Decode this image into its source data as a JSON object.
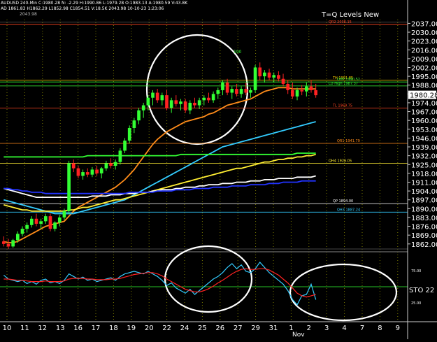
{
  "header": {
    "ohlc_line": "AUDUSD 240-Min  C:1980.28  N:  -2.29  H:1990.86  L:1979.28  O:1983.13  A:1980.59  V:43.8K",
    "line2": "AD 1861.83  H1862.29  L1852.98  C1854.51  V:18.5K  2043.98  10-10-23  1:23:06",
    "corner_value": "2043.98"
  },
  "chart_data": [
    {
      "type": "line",
      "title": "T=Q Levels New",
      "ylim": [
        1858,
        2040
      ],
      "y_ticks": [
        2037.0,
        2030.0,
        2023.0,
        2016.0,
        2009.0,
        2002.0,
        1995.0,
        1988.0,
        1981.0,
        1974.0,
        1967.0,
        1960.0,
        1953.0,
        1946.0,
        1939.0,
        1932.0,
        1925.0,
        1918.0,
        1911.0,
        1904.0,
        1897.0,
        1890.0,
        1883.0,
        1876.0,
        1869.0,
        1862.0
      ],
      "last_price": "1980.28",
      "x_tick_labels": [
        "10",
        "11",
        "12",
        "13",
        "16",
        "17",
        "18",
        "19",
        "20",
        "22",
        "24",
        "25",
        "26",
        "27",
        "29",
        "31",
        "1",
        "2",
        "3",
        "4",
        "7",
        "8",
        "9"
      ],
      "x_month_label": "Nov",
      "candles": [
        {
          "o": 1864,
          "h": 1868,
          "l": 1860,
          "c": 1862
        },
        {
          "o": 1862,
          "h": 1866,
          "l": 1858,
          "c": 1860
        },
        {
          "o": 1860,
          "h": 1866,
          "l": 1859,
          "c": 1865
        },
        {
          "o": 1865,
          "h": 1872,
          "l": 1863,
          "c": 1870
        },
        {
          "o": 1870,
          "h": 1876,
          "l": 1868,
          "c": 1874
        },
        {
          "o": 1874,
          "h": 1879,
          "l": 1871,
          "c": 1877
        },
        {
          "o": 1877,
          "h": 1884,
          "l": 1875,
          "c": 1882
        },
        {
          "o": 1882,
          "h": 1886,
          "l": 1876,
          "c": 1878
        },
        {
          "o": 1878,
          "h": 1882,
          "l": 1874,
          "c": 1880
        },
        {
          "o": 1880,
          "h": 1886,
          "l": 1878,
          "c": 1884
        },
        {
          "o": 1884,
          "h": 1886,
          "l": 1872,
          "c": 1874
        },
        {
          "o": 1874,
          "h": 1880,
          "l": 1872,
          "c": 1879
        },
        {
          "o": 1879,
          "h": 1885,
          "l": 1876,
          "c": 1883
        },
        {
          "o": 1883,
          "h": 1890,
          "l": 1881,
          "c": 1888
        },
        {
          "o": 1888,
          "h": 1928,
          "l": 1886,
          "c": 1926
        },
        {
          "o": 1926,
          "h": 1929,
          "l": 1919,
          "c": 1922
        },
        {
          "o": 1922,
          "h": 1924,
          "l": 1914,
          "c": 1916
        },
        {
          "o": 1916,
          "h": 1921,
          "l": 1913,
          "c": 1919
        },
        {
          "o": 1919,
          "h": 1922,
          "l": 1915,
          "c": 1917
        },
        {
          "o": 1917,
          "h": 1923,
          "l": 1915,
          "c": 1921
        },
        {
          "o": 1921,
          "h": 1924,
          "l": 1916,
          "c": 1918
        },
        {
          "o": 1918,
          "h": 1923,
          "l": 1914,
          "c": 1922
        },
        {
          "o": 1922,
          "h": 1928,
          "l": 1920,
          "c": 1926
        },
        {
          "o": 1926,
          "h": 1930,
          "l": 1922,
          "c": 1924
        },
        {
          "o": 1924,
          "h": 1929,
          "l": 1921,
          "c": 1927
        },
        {
          "o": 1927,
          "h": 1938,
          "l": 1925,
          "c": 1936
        },
        {
          "o": 1936,
          "h": 1946,
          "l": 1934,
          "c": 1944
        },
        {
          "o": 1944,
          "h": 1956,
          "l": 1942,
          "c": 1954
        },
        {
          "o": 1954,
          "h": 1962,
          "l": 1950,
          "c": 1960
        },
        {
          "o": 1960,
          "h": 1970,
          "l": 1957,
          "c": 1968
        },
        {
          "o": 1968,
          "h": 1974,
          "l": 1962,
          "c": 1972
        },
        {
          "o": 1972,
          "h": 1980,
          "l": 1968,
          "c": 1978
        },
        {
          "o": 1978,
          "h": 1984,
          "l": 1972,
          "c": 1982
        },
        {
          "o": 1982,
          "h": 1985,
          "l": 1974,
          "c": 1976
        },
        {
          "o": 1976,
          "h": 1982,
          "l": 1972,
          "c": 1980
        },
        {
          "o": 1980,
          "h": 1984,
          "l": 1968,
          "c": 1970
        },
        {
          "o": 1970,
          "h": 1978,
          "l": 1966,
          "c": 1976
        },
        {
          "o": 1976,
          "h": 1980,
          "l": 1971,
          "c": 1973
        },
        {
          "o": 1973,
          "h": 1977,
          "l": 1968,
          "c": 1975
        },
        {
          "o": 1975,
          "h": 1977,
          "l": 1966,
          "c": 1968
        },
        {
          "o": 1968,
          "h": 1976,
          "l": 1965,
          "c": 1974
        },
        {
          "o": 1974,
          "h": 1978,
          "l": 1970,
          "c": 1972
        },
        {
          "o": 1972,
          "h": 1978,
          "l": 1969,
          "c": 1976
        },
        {
          "o": 1976,
          "h": 1980,
          "l": 1972,
          "c": 1978
        },
        {
          "o": 1978,
          "h": 1982,
          "l": 1974,
          "c": 1976
        },
        {
          "o": 1976,
          "h": 1983,
          "l": 1974,
          "c": 1981
        },
        {
          "o": 1981,
          "h": 1986,
          "l": 1977,
          "c": 1984
        },
        {
          "o": 1984,
          "h": 1992,
          "l": 1980,
          "c": 1990
        },
        {
          "o": 1990,
          "h": 1993,
          "l": 1980,
          "c": 1982
        },
        {
          "o": 1982,
          "h": 1987,
          "l": 1977,
          "c": 1985
        },
        {
          "o": 1985,
          "h": 1989,
          "l": 1979,
          "c": 1981
        },
        {
          "o": 1981,
          "h": 1987,
          "l": 1978,
          "c": 1985
        },
        {
          "o": 1985,
          "h": 1990,
          "l": 1980,
          "c": 1982
        },
        {
          "o": 1982,
          "h": 1986,
          "l": 1978,
          "c": 1984
        },
        {
          "o": 1984,
          "h": 2004,
          "l": 1982,
          "c": 2002
        },
        {
          "o": 2002,
          "h": 2006,
          "l": 1992,
          "c": 1995
        },
        {
          "o": 1995,
          "h": 2000,
          "l": 1990,
          "c": 1998
        },
        {
          "o": 1998,
          "h": 2001,
          "l": 1992,
          "c": 1994
        },
        {
          "o": 1994,
          "h": 1998,
          "l": 1990,
          "c": 1996
        },
        {
          "o": 1996,
          "h": 1999,
          "l": 1991,
          "c": 1993
        },
        {
          "o": 1993,
          "h": 1997,
          "l": 1987,
          "c": 1989
        },
        {
          "o": 1989,
          "h": 1992,
          "l": 1981,
          "c": 1984
        },
        {
          "o": 1984,
          "h": 1990,
          "l": 1977,
          "c": 1979
        },
        {
          "o": 1979,
          "h": 1986,
          "l": 1976,
          "c": 1984
        },
        {
          "o": 1984,
          "h": 1988,
          "l": 1980,
          "c": 1983
        },
        {
          "o": 1983,
          "h": 1990,
          "l": 1979,
          "c": 1987
        },
        {
          "o": 1987,
          "h": 1992,
          "l": 1982,
          "c": 1984
        },
        {
          "o": 1984,
          "h": 1989,
          "l": 1978,
          "c": 1980
        }
      ],
      "moving_averages": [
        {
          "color": "#ff8c1a",
          "values": [
            1864,
            1863,
            1863,
            1864,
            1866,
            1868,
            1870,
            1872,
            1874,
            1876,
            1877,
            1878,
            1879,
            1880,
            1884,
            1888,
            1891,
            1893,
            1895,
            1897,
            1899,
            1901,
            1903,
            1905,
            1907,
            1910,
            1913,
            1917,
            1921,
            1926,
            1931,
            1936,
            1941,
            1945,
            1948,
            1951,
            1953,
            1955,
            1957,
            1959,
            1960,
            1961,
            1962,
            1963,
            1965,
            1966,
            1968,
            1970,
            1972,
            1973,
            1974,
            1975,
            1976,
            1977,
            1979,
            1981,
            1983,
            1984,
            1985,
            1986,
            1986,
            1986,
            1985,
            1985,
            1985,
            1985,
            1985,
            1985
          ]
        },
        {
          "color": "#33ccff",
          "values": [
            1897,
            1896,
            1895,
            1894,
            1893,
            1892,
            1891,
            1890,
            1889,
            1888,
            1887,
            1886,
            1886,
            1886,
            1886,
            1886,
            1887,
            1888,
            1889,
            1890,
            1891,
            1892,
            1893,
            1894,
            1895,
            1896,
            1897,
            1899,
            1901,
            1903,
            1905,
            1907,
            1909,
            1911,
            1913,
            1915,
            1917,
            1919,
            1921,
            1923,
            1925,
            1927,
            1929,
            1931,
            1933,
            1935,
            1937,
            1939,
            1940,
            1941,
            1942,
            1943,
            1944,
            1945,
            1946,
            1947,
            1948,
            1949,
            1950,
            1951,
            1952,
            1953,
            1954,
            1955,
            1956,
            1957,
            1958,
            1959
          ]
        },
        {
          "color": "#ffee33",
          "values": [
            1893,
            1892,
            1891,
            1890,
            1889,
            1889,
            1888,
            1888,
            1888,
            1888,
            1888,
            1888,
            1888,
            1888,
            1889,
            1889,
            1890,
            1891,
            1891,
            1892,
            1893,
            1894,
            1895,
            1896,
            1897,
            1897,
            1898,
            1899,
            1900,
            1901,
            1902,
            1903,
            1904,
            1905,
            1906,
            1907,
            1908,
            1909,
            1910,
            1911,
            1912,
            1913,
            1914,
            1915,
            1916,
            1917,
            1918,
            1919,
            1920,
            1921,
            1922,
            1922,
            1923,
            1924,
            1925,
            1926,
            1927,
            1927,
            1928,
            1929,
            1929,
            1930,
            1930,
            1931,
            1931,
            1932,
            1932,
            1933
          ]
        },
        {
          "color": "#ffffff",
          "values": [
            1906,
            1905,
            1904,
            1903,
            1902,
            1901,
            1900,
            1899,
            1899,
            1899,
            1899,
            1899,
            1899,
            1899,
            1899,
            1899,
            1899,
            1899,
            1899,
            1900,
            1900,
            1900,
            1900,
            1901,
            1901,
            1901,
            1902,
            1902,
            1902,
            1903,
            1903,
            1903,
            1904,
            1904,
            1905,
            1905,
            1905,
            1906,
            1906,
            1907,
            1907,
            1907,
            1908,
            1908,
            1909,
            1909,
            1909,
            1910,
            1910,
            1910,
            1911,
            1911,
            1911,
            1912,
            1912,
            1912,
            1913,
            1913,
            1913,
            1914,
            1914,
            1914,
            1914,
            1915,
            1915,
            1915,
            1915,
            1916
          ]
        },
        {
          "color": "#2233ff",
          "values": [
            1906,
            1906,
            1905,
            1905,
            1904,
            1904,
            1903,
            1903,
            1903,
            1902,
            1902,
            1902,
            1902,
            1902,
            1902,
            1902,
            1902,
            1902,
            1902,
            1902,
            1902,
            1902,
            1902,
            1902,
            1902,
            1902,
            1902,
            1903,
            1903,
            1903,
            1903,
            1903,
            1903,
            1904,
            1904,
            1904,
            1904,
            1905,
            1905,
            1905,
            1905,
            1906,
            1906,
            1906,
            1906,
            1907,
            1907,
            1907,
            1907,
            1908,
            1908,
            1908,
            1908,
            1909,
            1909,
            1909,
            1909,
            1910,
            1910,
            1910,
            1911,
            1911,
            1911,
            1911,
            1912,
            1912,
            1912,
            1912
          ]
        },
        {
          "color": "#33ff33",
          "values": [
            1931,
            1931,
            1931,
            1931,
            1931,
            1931,
            1931,
            1931,
            1931,
            1931,
            1931,
            1931,
            1931,
            1931,
            1931,
            1931,
            1931,
            1931,
            1932,
            1932,
            1932,
            1932,
            1932,
            1932,
            1932,
            1932,
            1932,
            1932,
            1932,
            1932,
            1932,
            1932,
            1932,
            1932,
            1932,
            1932,
            1932,
            1932,
            1933,
            1933,
            1933,
            1933,
            1933,
            1933,
            1933,
            1933,
            1933,
            1933,
            1933,
            1933,
            1933,
            1933,
            1933,
            1933,
            1933,
            1933,
            1933,
            1933,
            1933,
            1933,
            1933,
            1933,
            1933,
            1934,
            1934,
            1934,
            1934,
            1934
          ]
        }
      ],
      "levels": [
        {
          "price": 2036.15,
          "label": "QR2  2036.15",
          "color": "#ff4422"
        },
        {
          "price": 1991.85,
          "label": "TH  1991.85",
          "color": "#ffcc00"
        },
        {
          "price": 1990.52,
          "label": "QHP  1990.52",
          "color": "#33ff33"
        },
        {
          "price": 1987.37,
          "label": "LD High  1987.37",
          "color": "#33ff33"
        },
        {
          "price": 1969.75,
          "label": "TL  1969.75",
          "color": "#ff4422"
        },
        {
          "price": 1941.79,
          "label": "QR1  1941.79",
          "color": "#ff8c1a"
        },
        {
          "price": 1926.05,
          "label": "QH4  1926.05",
          "color": "#ffee33"
        },
        {
          "price": 1894.0,
          "label": "QP  1894.00",
          "color": "#ffffff"
        },
        {
          "price": 1887.24,
          "label": "QH3  1887.24",
          "color": "#33ccff"
        }
      ],
      "annotations": [
        "190"
      ]
    },
    {
      "type": "line",
      "title": "STO 22",
      "ylim": [
        0,
        100
      ],
      "y_ticks": [
        75.0,
        25.0
      ],
      "series": [
        {
          "color": "#33ccff",
          "values": [
            68,
            62,
            60,
            58,
            60,
            55,
            58,
            54,
            60,
            62,
            56,
            58,
            55,
            60,
            70,
            66,
            62,
            65,
            60,
            62,
            58,
            60,
            62,
            64,
            60,
            66,
            70,
            72,
            74,
            72,
            70,
            74,
            70,
            66,
            60,
            52,
            56,
            48,
            44,
            40,
            46,
            38,
            44,
            50,
            56,
            62,
            66,
            72,
            80,
            86,
            78,
            84,
            74,
            72,
            78,
            88,
            80,
            72,
            66,
            60,
            54,
            44,
            30,
            22,
            36,
            38,
            54,
            30
          ]
        },
        {
          "color": "#ff2222",
          "values": [
            62,
            62,
            61,
            60,
            60,
            59,
            58,
            58,
            58,
            59,
            58,
            58,
            58,
            59,
            62,
            63,
            63,
            63,
            62,
            62,
            61,
            61,
            61,
            62,
            62,
            63,
            65,
            67,
            69,
            70,
            71,
            72,
            72,
            70,
            67,
            62,
            58,
            54,
            50,
            46,
            44,
            42,
            42,
            44,
            47,
            51,
            56,
            60,
            65,
            70,
            74,
            77,
            78,
            77,
            77,
            78,
            78,
            76,
            72,
            68,
            62,
            56,
            48,
            40,
            36,
            34,
            36,
            38
          ]
        }
      ]
    }
  ]
}
